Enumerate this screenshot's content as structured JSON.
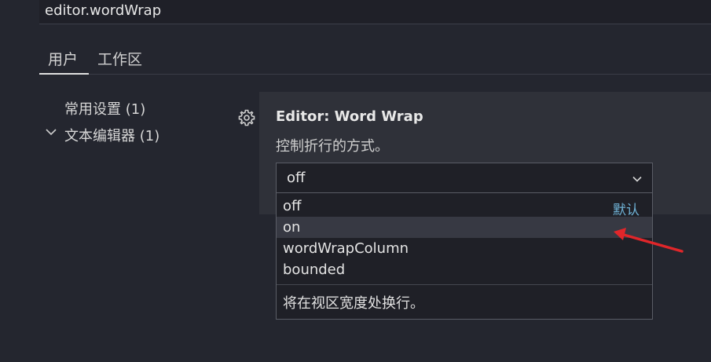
{
  "search": {
    "value": "editor.wordWrap"
  },
  "tabs": [
    {
      "label": "用户"
    },
    {
      "label": "工作区"
    }
  ],
  "toc": [
    {
      "label": "常用设置 (1)"
    },
    {
      "label": "文本编辑器 (1)"
    }
  ],
  "setting": {
    "title": "Editor: Word Wrap",
    "description": "控制折行的方式。",
    "current_value": "off"
  },
  "dropdown": {
    "options": [
      {
        "label": "off",
        "tag": "默认"
      },
      {
        "label": "on"
      },
      {
        "label": "wordWrapColumn"
      },
      {
        "label": "bounded"
      }
    ],
    "hovered_index": 1,
    "description": "将在视区宽度处换行。"
  },
  "icons": {
    "gear": "gear-icon",
    "chevron": "chevron-down-icon",
    "annotation": "red-arrow-icon"
  },
  "colors": {
    "accent_default_tag": "#6fb2d6",
    "annotation_arrow": "#e0262a",
    "background": "#24262f"
  }
}
